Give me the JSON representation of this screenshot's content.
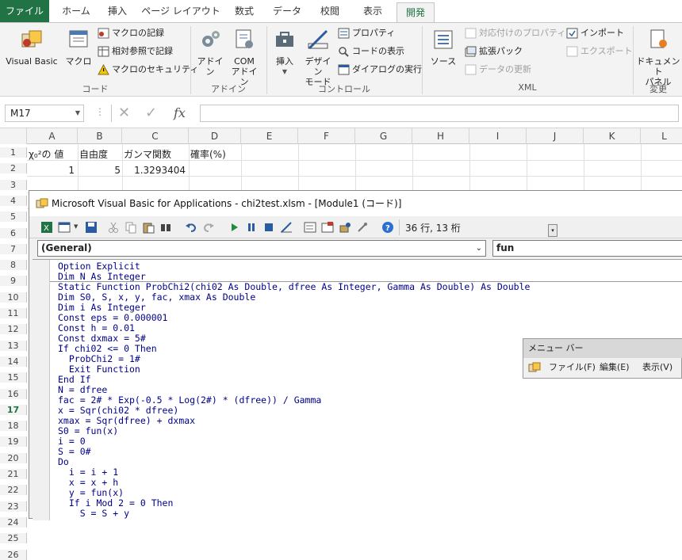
{
  "ribbon_tabs": [
    "ファイル",
    "ホーム",
    "挿入",
    "ページ レイアウト",
    "数式",
    "データ",
    "校閲",
    "表示",
    "開発"
  ],
  "ribbon": {
    "code_group": {
      "label": "コード",
      "visual_basic": "Visual Basic",
      "macro": "マクロ",
      "record_macro": "マクロの記録",
      "relative_ref": "相対参照で記録",
      "macro_security": "マクロのセキュリティ"
    },
    "addin_group": {
      "label": "アドイン",
      "addin": "アドイン",
      "com_addin_1": "COM",
      "com_addin_2": "アドイン"
    },
    "control_group": {
      "label": "コントロール",
      "insert": "挿入",
      "design_mode_1": "デザイン",
      "design_mode_2": "モード",
      "properties": "プロパティ",
      "view_code": "コードの表示",
      "run_dialog": "ダイアログの実行"
    },
    "xml_group": {
      "label": "XML",
      "source": "ソース",
      "map_properties": "対応付けのプロパティ",
      "expansion_packs": "拡張パック",
      "refresh_data": "データの更新",
      "import": "インポート",
      "export": "エクスポート"
    },
    "modify_group": {
      "label": "変更",
      "doc_panel_1": "ドキュメント",
      "doc_panel_2": "パネル"
    }
  },
  "formula_bar": {
    "name_box": "M17",
    "cancel": "✕",
    "enter": "✓",
    "fx": "fx",
    "formula": ""
  },
  "columns": [
    "A",
    "B",
    "C",
    "D",
    "E",
    "F",
    "G",
    "H",
    "I",
    "J",
    "K",
    "L"
  ],
  "rows": [
    "1",
    "2",
    "3",
    "4",
    "5",
    "6",
    "7",
    "8",
    "9",
    "10",
    "11",
    "12",
    "13",
    "14",
    "15",
    "16",
    "17",
    "18",
    "19",
    "20",
    "21",
    "22",
    "23",
    "24",
    "25",
    "26"
  ],
  "active_row": "17",
  "cells": {
    "A1": "χ₀²の 値",
    "B1": "自由度",
    "C1": "ガンマ関数",
    "D1": "確率(%)",
    "A2": "1",
    "B2": "5",
    "C2": "1.3293404"
  },
  "vba": {
    "title": "Microsoft Visual Basic for Applications - chi2test.xlsm - [Module1 (コード)]",
    "status": "36 行, 13 桁",
    "object_combo": "(General)",
    "proc_combo": "fun",
    "code_lines": [
      "Option Explicit",
      "Dim N As Integer",
      "Static Function ProbChi2(chi02 As Double, dfree As Integer, Gamma As Double) As Double",
      "Dim S0, S, x, y, fac, xmax As Double",
      "Dim i As Integer",
      "Const eps = 0.000001",
      "Const h = 0.01",
      "Const dxmax = 5#",
      "If chi02 <= 0 Then",
      "  ProbChi2 = 1#",
      "  Exit Function",
      "End If",
      "N = dfree",
      "fac = 2# * Exp(-0.5 * Log(2#) * (dfree)) / Gamma",
      "x = Sqr(chi02 * dfree)",
      "xmax = Sqr(dfree) + dxmax",
      "S0 = fun(x)",
      "i = 0",
      "S = 0#",
      "Do",
      "  i = i + 1",
      "  x = x + h",
      "  y = fun(x)",
      "  If i Mod 2 = 0 Then",
      "    S = S + y"
    ]
  },
  "menu_bar": {
    "title": "メニュー バー",
    "items": [
      "ファイル(F)",
      "編集(E)",
      "表示(V)"
    ]
  }
}
